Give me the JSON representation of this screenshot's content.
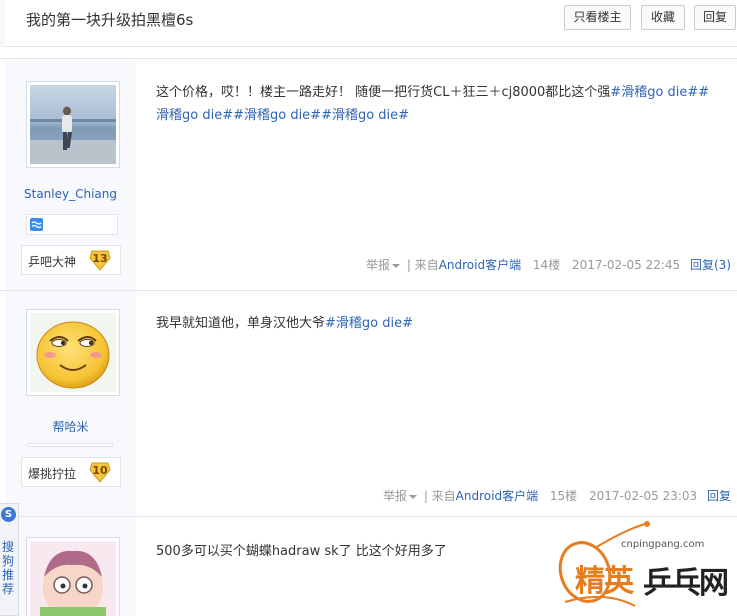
{
  "header": {
    "title": "我的第一块升级拍黑檀6s",
    "buttons": [
      "只看楼主",
      "收藏",
      "回复"
    ]
  },
  "posts": [
    {
      "author": "Stanley_Chiang",
      "level_name": "乒吧大神",
      "level": "13",
      "content_text": "这个价格，哎！！楼主一路走好！ 随便一把行货CL＋狂三＋cj8000都比这个强",
      "topics": "#滑稽go die##滑稽go die##滑稽go die##滑稽go die#",
      "report": "举报",
      "source_prefix": "| 来自",
      "source": "Android客户端",
      "floor": "14楼",
      "time": "2017-02-05 22:45",
      "reply": "回复(3)"
    },
    {
      "author": "帮哈米",
      "level_name": "爆挑拧拉",
      "level": "10",
      "content_text": "我早就知道他，单身汉他大爷",
      "topics": "#滑稽go die#",
      "report": "举报",
      "source_prefix": "| 来自",
      "source": "Android客户端",
      "floor": "15楼",
      "time": "2017-02-05 23:03",
      "reply": "回复"
    },
    {
      "content_text": "500多可以买个蝴蝶hadraw sk了 比这个好用多了"
    }
  ],
  "share_tab": {
    "icon_letter": "S",
    "text": "搜狗推荐"
  },
  "watermark": {
    "url": "cnpingpang.com",
    "brand_a": "精英",
    "brand_b": "乒乓网"
  },
  "colors": {
    "link": "#2d64b3",
    "meta": "#999999",
    "author_bg": "#f7f9fc",
    "badge": "#f5c542"
  }
}
